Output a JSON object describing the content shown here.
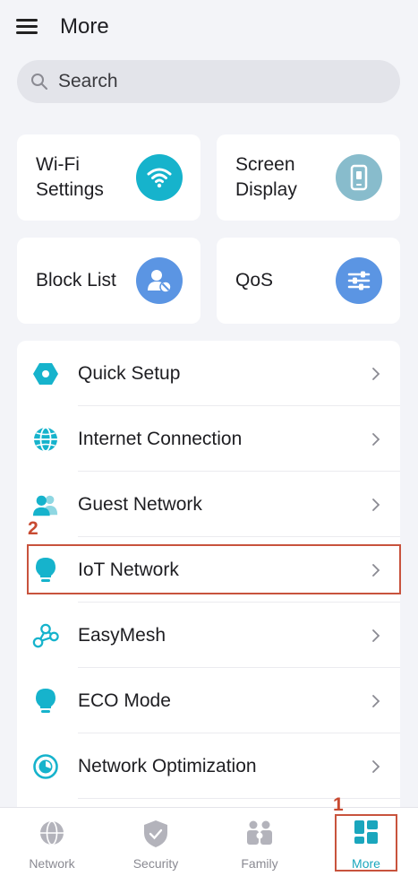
{
  "header": {
    "title": "More"
  },
  "search": {
    "placeholder": "Search"
  },
  "cards": [
    {
      "label": "Wi‑Fi Settings",
      "icon": "wifi-icon",
      "color": "#16b3cc"
    },
    {
      "label": "Screen Display",
      "icon": "phone-screen-icon",
      "color": "#88bccc"
    },
    {
      "label": "Block List",
      "icon": "block-user-icon",
      "color": "#5b95e3"
    },
    {
      "label": "QoS",
      "icon": "sliders-icon",
      "color": "#5b95e3"
    }
  ],
  "list": [
    {
      "label": "Quick Setup",
      "icon": "hexagon-icon"
    },
    {
      "label": "Internet Connection",
      "icon": "globe-icon"
    },
    {
      "label": "Guest Network",
      "icon": "guests-icon"
    },
    {
      "label": "IoT Network",
      "icon": "bulb-icon"
    },
    {
      "label": "EasyMesh",
      "icon": "mesh-icon"
    },
    {
      "label": "ECO Mode",
      "icon": "eco-bulb-icon"
    },
    {
      "label": "Network Optimization",
      "icon": "optimization-icon"
    }
  ],
  "annotations": {
    "first": "1",
    "second": "2"
  },
  "tabs": [
    {
      "label": "Network",
      "icon": "globe-tab-icon"
    },
    {
      "label": "Security",
      "icon": "shield-icon"
    },
    {
      "label": "Family",
      "icon": "family-icon"
    },
    {
      "label": "More",
      "icon": "grid-icon",
      "active": true
    }
  ],
  "colors": {
    "accent": "#1aa6bd",
    "annotation": "#c8533d"
  }
}
